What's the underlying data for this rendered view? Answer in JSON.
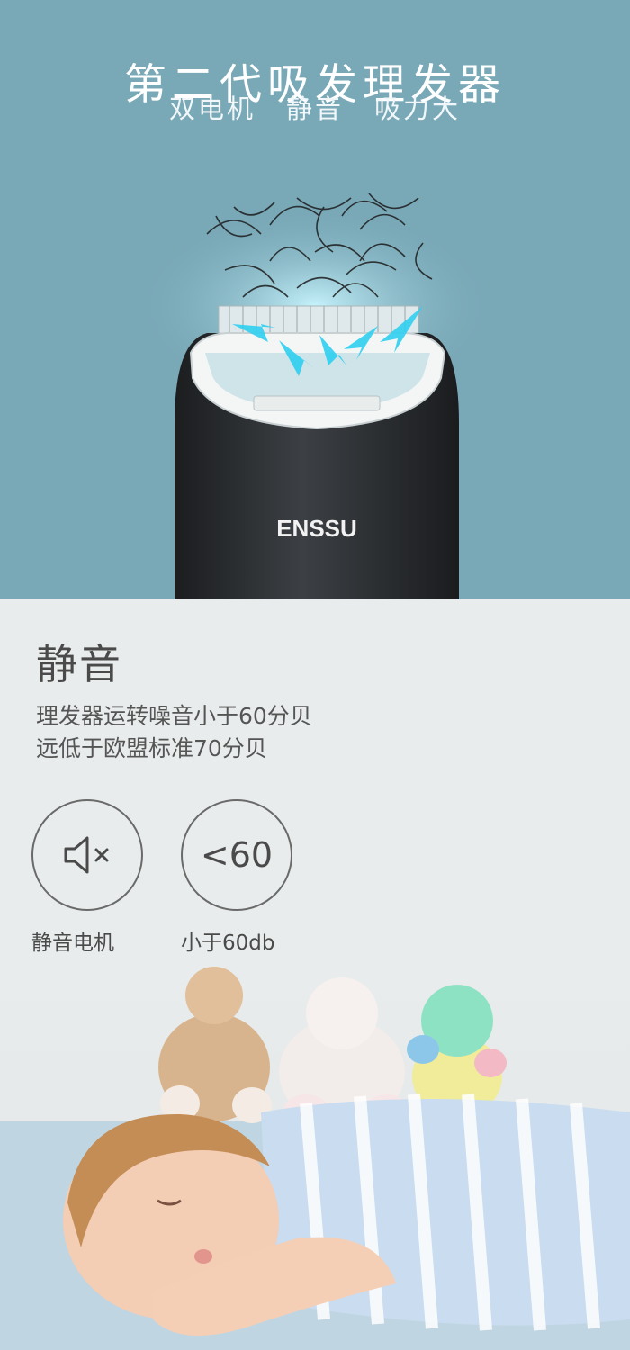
{
  "hero": {
    "title": "第二代吸发理发器",
    "features": [
      "双电机",
      "静音",
      "吸力大"
    ],
    "brand": "ENSSU"
  },
  "feature": {
    "title": "静音",
    "desc_lines": [
      "理发器运转噪音小于60分贝",
      "远低于欧盟标准70分贝"
    ],
    "icons": [
      {
        "icon": "mute-speaker-icon",
        "label": "静音电机"
      },
      {
        "value": "<60",
        "label": "小于60db"
      }
    ]
  },
  "colors": {
    "hero_bg": "#79a8b7",
    "feature_bg": "#e8ecec",
    "accent_arrow": "#2fd0f0",
    "device_body": "#2e3134"
  }
}
